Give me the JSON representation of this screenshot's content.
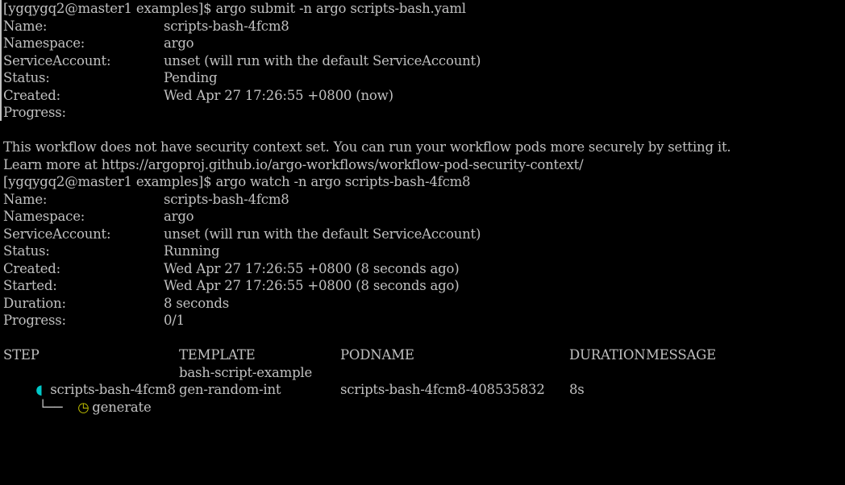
{
  "terminal": {
    "submit_block": {
      "prompt": "[ygqygq2@master1 examples]$ argo submit -n argo scripts-bash.yaml",
      "fields": [
        {
          "key": "Name:",
          "value": "scripts-bash-4fcm8"
        },
        {
          "key": "Namespace:",
          "value": "argo"
        },
        {
          "key": "ServiceAccount:",
          "value": "unset (will run with the default ServiceAccount)"
        },
        {
          "key": "Status:",
          "value": "Pending"
        },
        {
          "key": "Created:",
          "value": "Wed Apr 27 17:26:55 +0800 (now)"
        },
        {
          "key": "Progress:",
          "value": ""
        }
      ],
      "notice_1": "This workflow does not have security context set. You can run your workflow pods more securely by setting it.",
      "notice_2": "Learn more at https://argoproj.github.io/argo-workflows/workflow-pod-security-context/"
    },
    "watch_block": {
      "prompt": "[ygqygq2@master1 examples]$ argo watch -n argo scripts-bash-4fcm8",
      "fields": [
        {
          "key": "Name:",
          "value": "scripts-bash-4fcm8"
        },
        {
          "key": "Namespace:",
          "value": "argo"
        },
        {
          "key": "ServiceAccount:",
          "value": "unset (will run with the default ServiceAccount)"
        },
        {
          "key": "Status:",
          "value": "Running"
        },
        {
          "key": "Created:",
          "value": "Wed Apr 27 17:26:55 +0800 (8 seconds ago)"
        },
        {
          "key": "Started:",
          "value": "Wed Apr 27 17:26:55 +0800 (8 seconds ago)"
        },
        {
          "key": "Duration:",
          "value": "8 seconds"
        },
        {
          "key": "Progress:",
          "value": "0/1"
        }
      ],
      "table": {
        "headers": {
          "step": "STEP",
          "template": "TEMPLATE",
          "podname": "PODNAME",
          "duration": "DURATION",
          "message": "MESSAGE"
        },
        "rows": [
          {
            "status_icon": "running-half-circle-icon",
            "status_glyph": "◖",
            "tree": "",
            "step": "scripts-bash-4fcm8",
            "template": "bash-script-example",
            "podname": "",
            "duration": "",
            "message": ""
          },
          {
            "status_icon": "pending-c-icon",
            "status_glyph": "◷",
            "tree": "└──",
            "step": "generate",
            "template": "gen-random-int",
            "podname": "scripts-bash-4fcm8-408535832",
            "duration": "8s",
            "message": ""
          }
        ]
      }
    },
    "colors": {
      "background": "#000000",
      "foreground": "#c0c0c0",
      "running_icon": "#00c8c8",
      "pending_icon": "#c8c800"
    }
  }
}
